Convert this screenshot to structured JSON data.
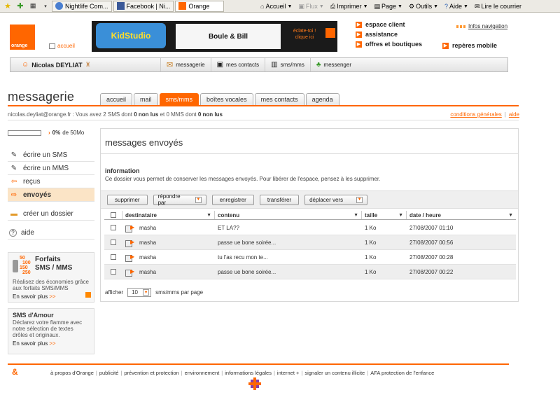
{
  "browser": {
    "tabs": [
      {
        "label": "Nightlife Com..."
      },
      {
        "label": "Facebook | Ni..."
      },
      {
        "label": "Orange"
      }
    ],
    "toolbar": {
      "home": "Accueil",
      "feeds": "Flux",
      "print": "Imprimer",
      "page": "Page",
      "tools": "Outils",
      "help": "Aide",
      "mail": "Lire le courrier"
    }
  },
  "header": {
    "logo_text": "orange",
    "home_link": "accueil",
    "banner": {
      "brand": "KidStudio",
      "title": "Boule & Bill",
      "promo": "éclate-toi ! clique ici"
    },
    "links": [
      "espace client",
      "assistance",
      "offres et boutiques"
    ],
    "info_nav": "Infos navigation",
    "reperes": "repères mobile"
  },
  "user_bar": {
    "name": "Nicolas DEYLIAT",
    "items": [
      "messagerie",
      "mes contacts",
      "sms/mms",
      "messenger"
    ]
  },
  "page": {
    "title": "messagerie",
    "tabs": [
      "accueil",
      "mail",
      "sms/mms",
      "boîtes vocales",
      "mes contacts",
      "agenda"
    ],
    "active_tab": "sms/mms",
    "status": {
      "email": "nicolas.deyliat@orange.fr",
      "p1": " : Vous avez 2 SMS dont ",
      "b1": "0 non lus",
      "p2": " et 0 MMS dont ",
      "b2": "0 non lus"
    },
    "status_links": [
      "conditions générales",
      "aide"
    ]
  },
  "sidebar": {
    "quota": {
      "percent": "0%",
      "label": "de 50Mo",
      "fill_fraction": 0.0
    },
    "items": [
      {
        "label": "écrire un SMS"
      },
      {
        "label": "écrire un MMS"
      },
      {
        "label": "reçus"
      },
      {
        "label": "envoyés"
      },
      {
        "label": "créer un dossier"
      },
      {
        "label": "aide"
      }
    ],
    "promo": {
      "nums": [
        "50",
        "100",
        "150",
        "250"
      ],
      "title_line1": "Forfaits",
      "title_line2": "SMS / MMS",
      "desc": "Réalisez des économies grâce aux forfaits SMS/MMS",
      "more": "En savoir plus"
    },
    "love": {
      "title": "SMS d'Amour",
      "desc": "Déclarez votre flamme avec notre sélection de textes drôles et originaux.",
      "more": "En savoir plus"
    }
  },
  "main": {
    "title": "messages envoyés",
    "info_title": "information",
    "info_text": "Ce dossier vous permet de conserver les messages envoyés. Pour libérer de l'espace, pensez à les supprimer.",
    "toolbar": {
      "delete": "supprimer",
      "reply": "répondre par",
      "save": "enregistrer",
      "forward": "transférer",
      "move": "déplacer vers"
    },
    "columns": {
      "recipient": "destinataire",
      "content": "contenu",
      "size": "taille",
      "date": "date / heure"
    },
    "rows": [
      {
        "recipient": "masha",
        "content": "ET LA??",
        "size": "1 Ko",
        "date": "27/08/2007 01:10"
      },
      {
        "recipient": "masha",
        "content": "passe ue bone soirée...",
        "size": "1 Ko",
        "date": "27/08/2007 00:56"
      },
      {
        "recipient": "masha",
        "content": "tu l'as recu mon te...",
        "size": "1 Ko",
        "date": "27/08/2007 00:28"
      },
      {
        "recipient": "masha",
        "content": "passe ue bone soirée...",
        "size": "1 Ko",
        "date": "27/08/2007 00:22"
      }
    ],
    "per_page": {
      "label_before": "afficher",
      "value": "10",
      "label_after": "sms/mms par page"
    }
  },
  "footer": {
    "links": [
      "à propos d'Orange",
      "publicité",
      "prévention et protection",
      "environnement",
      "informations légales",
      "internet +",
      "signaler un contenu illicite",
      "AFA protection de l'enfance"
    ]
  },
  "colors": {
    "brand": "#ff6600",
    "active_row": "#fbe4c6"
  }
}
